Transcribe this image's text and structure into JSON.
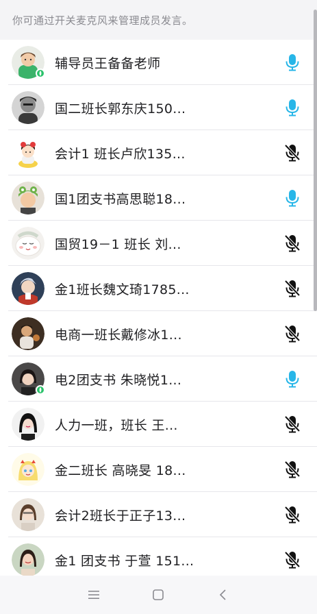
{
  "hint": {
    "text": "你可通过开关麦克风来管理成员发言。"
  },
  "colors": {
    "mic_on": "#27b6e8",
    "mic_off": "#111111",
    "online": "#2bc26b"
  },
  "members": [
    {
      "name": "辅导员王备备老师",
      "mic": "on",
      "online": true,
      "avatar": "boy-green"
    },
    {
      "name": "国二班长郭东庆150...",
      "mic": "on",
      "online": false,
      "avatar": "bw-man"
    },
    {
      "name": "会计1 班长卢欣135...",
      "mic": "off",
      "online": false,
      "avatar": "cartoon-girl"
    },
    {
      "name": "国1团支书高思聪18...",
      "mic": "on",
      "online": false,
      "avatar": "frog-hat"
    },
    {
      "name": "国贸19－1 班长 刘...",
      "mic": "off",
      "online": false,
      "avatar": "cute-face"
    },
    {
      "name": "金1班长魏文琦1785...",
      "mic": "off",
      "online": false,
      "avatar": "anime-boy"
    },
    {
      "name": "电商一班长戴修冰1...",
      "mic": "off",
      "online": false,
      "avatar": "dark-photo"
    },
    {
      "name": "电2团支书 朱晓悦1...",
      "mic": "on",
      "online": true,
      "avatar": "girl-photo"
    },
    {
      "name": "人力一班，班长  王...",
      "mic": "off",
      "online": false,
      "avatar": "girl-dark"
    },
    {
      "name": "金二班长 高晓旻 18...",
      "mic": "off",
      "online": false,
      "avatar": "star-cartoon"
    },
    {
      "name": "会计2班长于正子13...",
      "mic": "off",
      "online": false,
      "avatar": "girl-light"
    },
    {
      "name": "金1 团支书 于萱 151...",
      "mic": "off",
      "online": false,
      "avatar": "girl-smile"
    }
  ],
  "nav": {
    "menu_icon": "menu-icon",
    "home_icon": "home-square-icon",
    "back_icon": "back-chevron-icon"
  }
}
